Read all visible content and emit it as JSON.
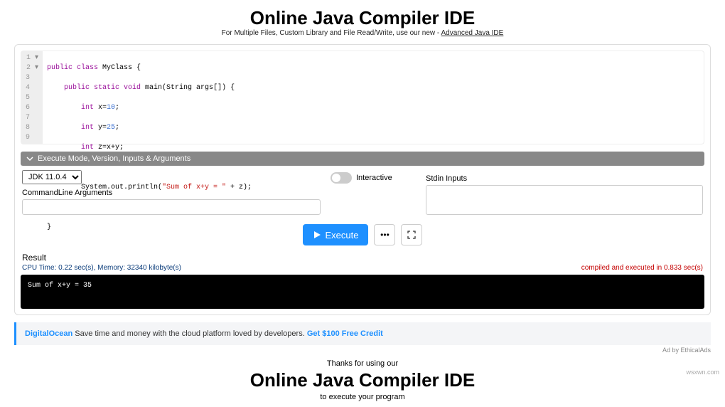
{
  "header": {
    "title": "Online Java Compiler IDE",
    "subtitle_prefix": "For Multiple Files, Custom Library and File Read/Write, use our new - ",
    "subtitle_link": "Advanced Java IDE"
  },
  "editor": {
    "lines": [
      {
        "n": "1",
        "fold": true
      },
      {
        "n": "2",
        "fold": true
      },
      {
        "n": "3"
      },
      {
        "n": "4"
      },
      {
        "n": "5"
      },
      {
        "n": "6"
      },
      {
        "n": "7"
      },
      {
        "n": "8"
      },
      {
        "n": "9"
      }
    ],
    "code": {
      "l1": {
        "a": "public ",
        "b": "class ",
        "c": "MyClass {"
      },
      "l2": {
        "a": "    public ",
        "b": "static ",
        "c": "void ",
        "d": "main(String args[]) {"
      },
      "l3": {
        "a": "        int ",
        "b": "x=",
        "c": "10",
        "d": ";"
      },
      "l4": {
        "a": "        int ",
        "b": "y=",
        "c": "25",
        "d": ";"
      },
      "l5": {
        "a": "        int ",
        "b": "z=x+y;"
      },
      "l6": {
        "a": ""
      },
      "l7": {
        "a": "        System.out.println(",
        "b": "\"Sum of x+y = \"",
        "c": " + z);"
      },
      "l8": {
        "a": "    }"
      },
      "l9": {
        "a": "}"
      }
    }
  },
  "options": {
    "bar_label": "Execute Mode, Version, Inputs & Arguments",
    "jdk_selected": "JDK 11.0.4",
    "interactive_label": "Interactive",
    "cmdline_label": "CommandLine Arguments",
    "stdin_label": "Stdin Inputs",
    "execute_label": "Execute"
  },
  "result": {
    "label": "Result",
    "stats_left": "CPU Time: 0.22 sec(s), Memory: 32340 kilobyte(s)",
    "stats_right": "compiled and executed in 0.833 sec(s)",
    "console": "Sum of x+y = 35"
  },
  "ad": {
    "brand": "DigitalOcean",
    "text": " Save time and money with the cloud platform loved by developers. ",
    "credit": "Get $100 Free Credit",
    "ad_by": "Ad by EthicalAds"
  },
  "footer": {
    "thanks": "Thanks for using our",
    "title": "Online Java Compiler IDE",
    "sub": "to execute your program"
  },
  "watermark": "wsxwn.com"
}
